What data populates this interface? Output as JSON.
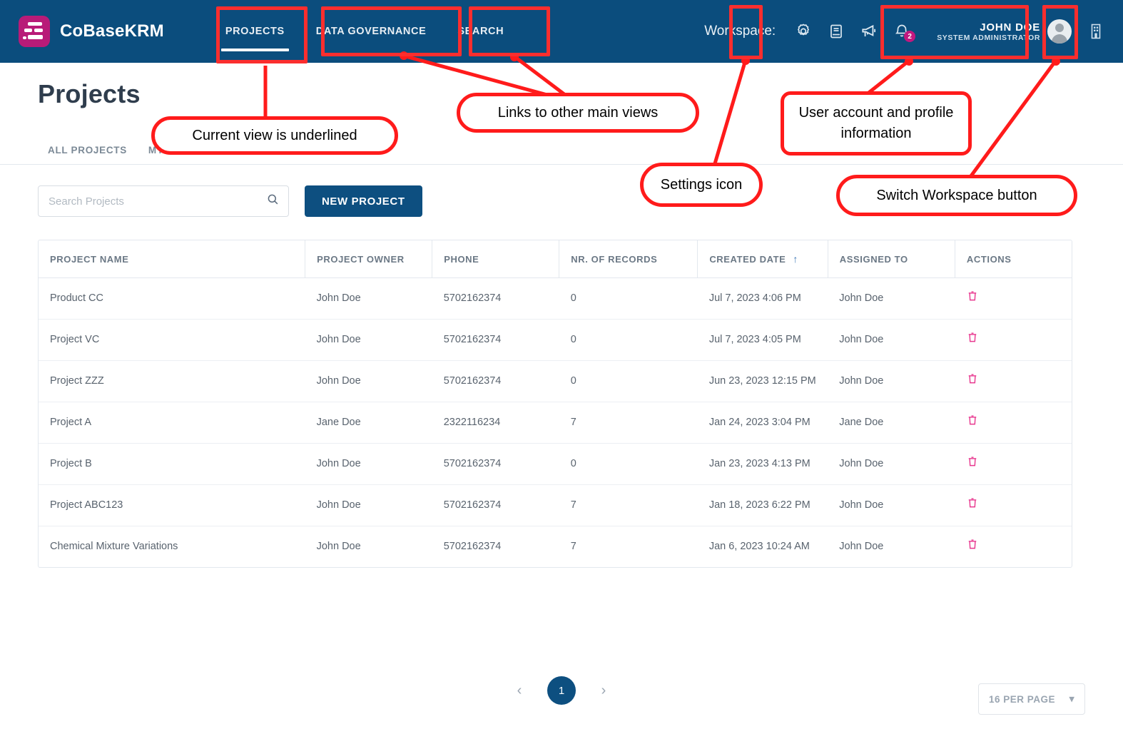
{
  "header": {
    "brand": "CoBaseKRM",
    "nav": [
      {
        "label": "PROJECTS",
        "active": true
      },
      {
        "label": "DATA GOVERNANCE",
        "active": false
      },
      {
        "label": "SEARCH",
        "active": false
      }
    ],
    "workspace_label": "Workspace:",
    "icons": {
      "settings": "gear-icon",
      "docs": "book-icon",
      "announcements": "megaphone-icon",
      "notifications": "bell-icon",
      "switch_workspace": "building-icon"
    },
    "notification_count": "2",
    "user": {
      "name": "JOHN DOE",
      "role": "SYSTEM ADMINISTRATOR"
    }
  },
  "page": {
    "title": "Projects",
    "tabs": [
      {
        "label": "ALL PROJECTS",
        "active": true
      },
      {
        "label": "MY",
        "active": false
      }
    ]
  },
  "toolbar": {
    "search_placeholder": "Search Projects",
    "search_value": "",
    "search_icon": "search-icon",
    "new_project_label": "NEW PROJECT"
  },
  "table": {
    "columns": [
      "PROJECT NAME",
      "PROJECT OWNER",
      "PHONE",
      "NR. OF RECORDS",
      "CREATED DATE",
      "ASSIGNED TO",
      "ACTIONS"
    ],
    "sorted_column": "CREATED DATE",
    "sort_direction": "↑",
    "rows": [
      {
        "name": "Product CC",
        "owner": "John Doe",
        "phone": "5702162374",
        "records": "0",
        "created": "Jul 7, 2023 4:06 PM",
        "assigned": "John Doe"
      },
      {
        "name": "Project VC",
        "owner": "John Doe",
        "phone": "5702162374",
        "records": "0",
        "created": "Jul 7, 2023 4:05 PM",
        "assigned": "John Doe"
      },
      {
        "name": "Project ZZZ",
        "owner": "John Doe",
        "phone": "5702162374",
        "records": "0",
        "created": "Jun 23, 2023 12:15 PM",
        "assigned": "John Doe"
      },
      {
        "name": "Project A",
        "owner": "Jane Doe",
        "phone": "2322116234",
        "records": "7",
        "created": "Jan 24, 2023 3:04 PM",
        "assigned": "Jane Doe"
      },
      {
        "name": "Project B",
        "owner": "John Doe",
        "phone": "5702162374",
        "records": "0",
        "created": "Jan 23, 2023 4:13 PM",
        "assigned": "John Doe"
      },
      {
        "name": "Project ABC123",
        "owner": "John Doe",
        "phone": "5702162374",
        "records": "7",
        "created": "Jan 18, 2023 6:22 PM",
        "assigned": "John Doe"
      },
      {
        "name": "Chemical Mixture Variations",
        "owner": "John Doe",
        "phone": "5702162374",
        "records": "7",
        "created": "Jan 6, 2023 10:24 AM",
        "assigned": "John Doe"
      }
    ]
  },
  "pagination": {
    "prev": "‹",
    "next": "›",
    "current_page": "1",
    "per_page": "16 PER PAGE"
  },
  "annotations": [
    {
      "id": "current-view",
      "text": "Current view is underlined"
    },
    {
      "id": "other-views",
      "text": "Links to other main views"
    },
    {
      "id": "settings",
      "text": "Settings icon"
    },
    {
      "id": "user-account",
      "text": "User account and profile information"
    },
    {
      "id": "switch-workspace",
      "text": "Switch Workspace button"
    }
  ],
  "colors": {
    "nav_bg": "#0b4d7d",
    "brand_mark": "#b81b78",
    "primary": "#0d4f80",
    "delete": "#e8388f",
    "annotation": "#ff1b1b",
    "badge": "#c2187f"
  }
}
